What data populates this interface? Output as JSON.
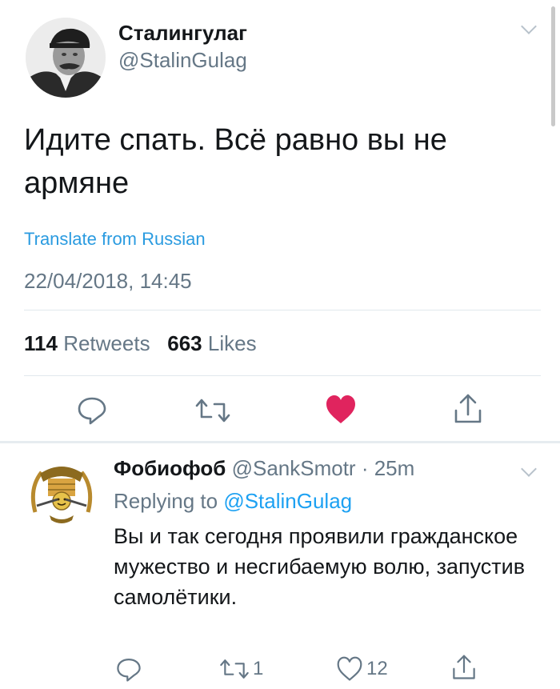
{
  "main_tweet": {
    "display_name": "Сталингулаг",
    "handle": "@StalinGulag",
    "text": "Идите спать. Всё равно вы не армяне",
    "translate_link": "Translate from Russian",
    "timestamp": "22/04/2018, 14:45",
    "retweets_count": "114",
    "retweets_label": "Retweets",
    "likes_count": "663",
    "likes_label": "Likes",
    "like_color": "#e0245e",
    "icons": [
      "reply-icon",
      "retweet-icon",
      "heart-icon",
      "share-icon",
      "chevron-down-icon"
    ]
  },
  "reply": {
    "display_name": "Фобиофоб",
    "handle": "@SankSmotr",
    "time": "· 25m",
    "replying_prefix": "Replying to",
    "replying_to": "@StalinGulag",
    "text": "Вы и так сегодня проявили гражданское мужество и несгибаемую волю, запустив самолётики.",
    "retweet_count": "1",
    "like_count": "12",
    "icons": [
      "reply-icon",
      "retweet-icon",
      "heart-outline-icon",
      "share-icon",
      "chevron-down-icon"
    ]
  },
  "colors": {
    "text_primary": "#14171a",
    "text_secondary": "#657786",
    "link": "#1da1f2",
    "divider": "#e1e8ed"
  }
}
